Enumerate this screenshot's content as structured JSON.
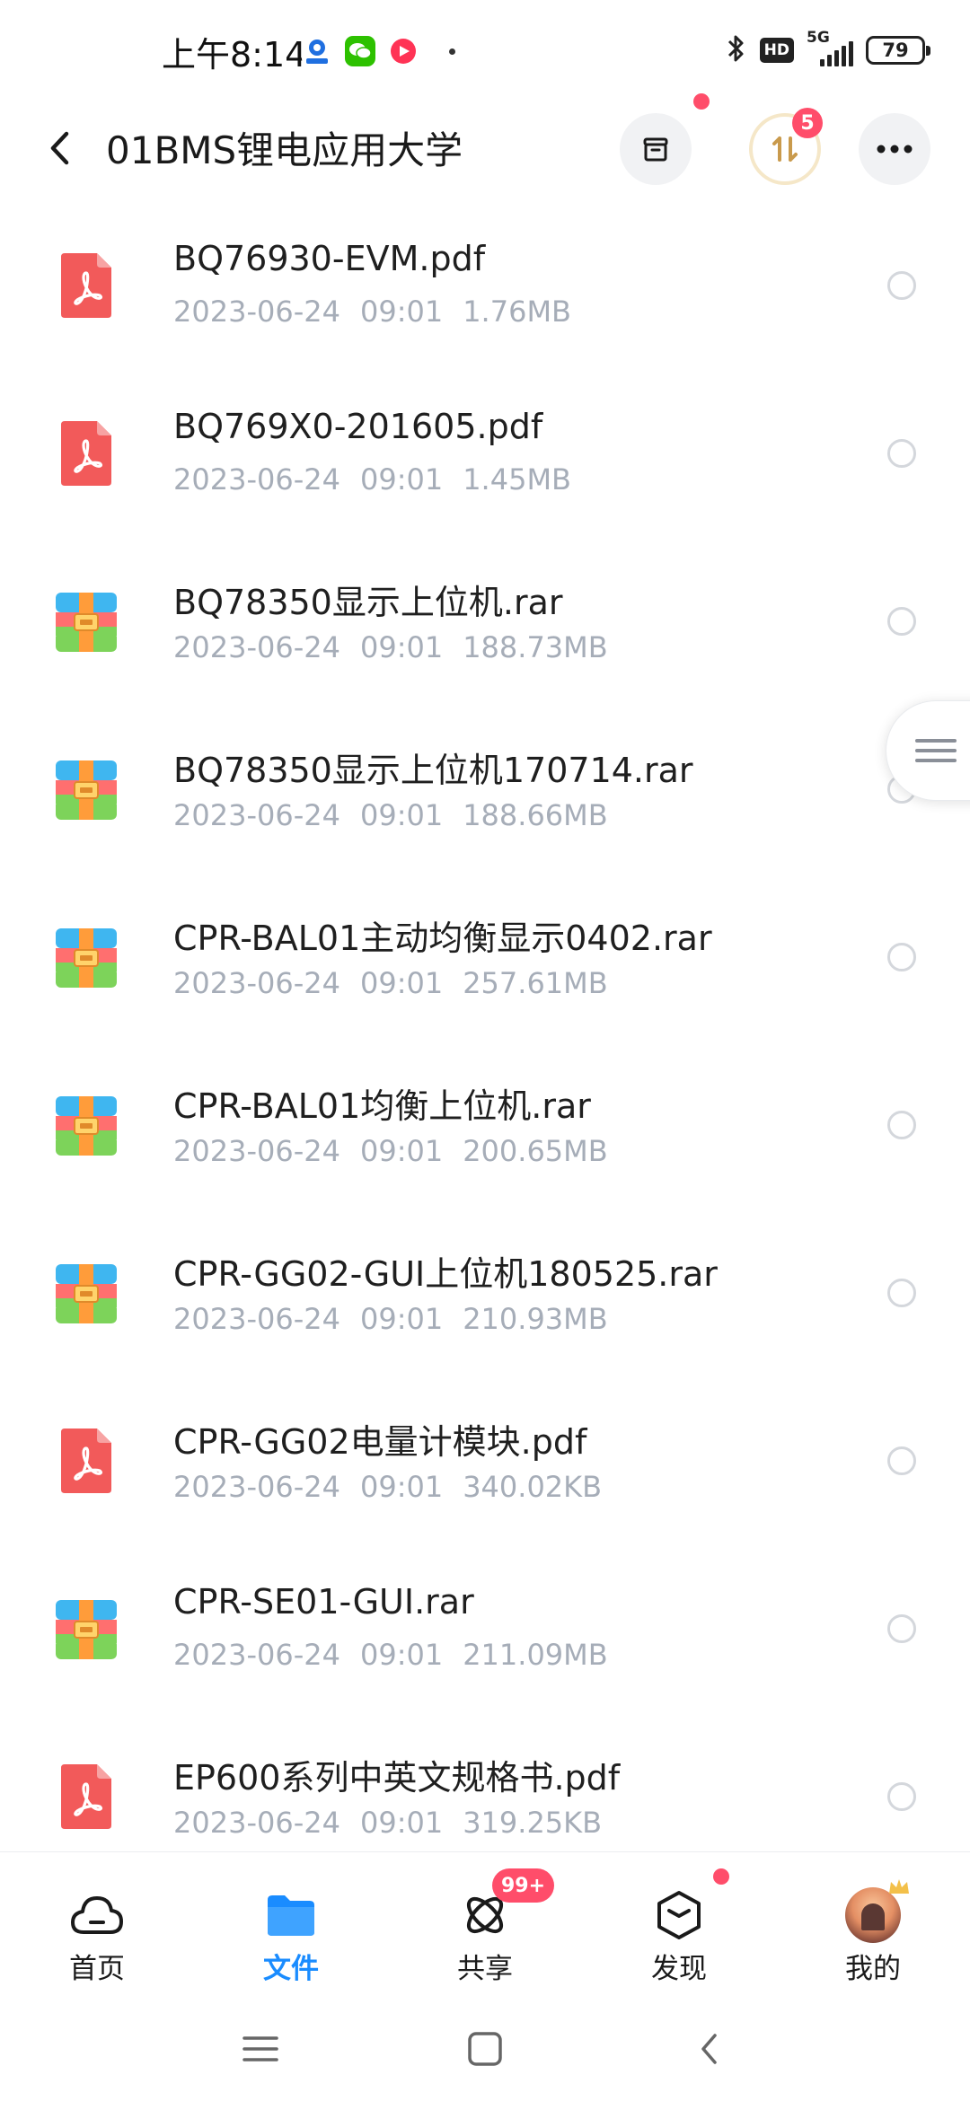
{
  "status_bar": {
    "time": "上午8:14",
    "network": "5G",
    "hd_label": "HD",
    "battery": "79"
  },
  "header": {
    "title": "01BMS锂电应用大学",
    "transfer_badge": "5"
  },
  "files": [
    {
      "name": "BQ76930-EVM.pdf",
      "date": "2023-06-24",
      "time": "09:01",
      "size": "1.76MB",
      "type": "pdf"
    },
    {
      "name": "BQ769X0-201605.pdf",
      "date": "2023-06-24",
      "time": "09:01",
      "size": "1.45MB",
      "type": "pdf"
    },
    {
      "name": "BQ78350显示上位机.rar",
      "date": "2023-06-24",
      "time": "09:01",
      "size": "188.73MB",
      "type": "rar"
    },
    {
      "name": "BQ78350显示上位机170714.rar",
      "date": "2023-06-24",
      "time": "09:01",
      "size": "188.66MB",
      "type": "rar"
    },
    {
      "name": "CPR-BAL01主动均衡显示0402.rar",
      "date": "2023-06-24",
      "time": "09:01",
      "size": "257.61MB",
      "type": "rar"
    },
    {
      "name": "CPR-BAL01均衡上位机.rar",
      "date": "2023-06-24",
      "time": "09:01",
      "size": "200.65MB",
      "type": "rar"
    },
    {
      "name": "CPR-GG02-GUI上位机180525.rar",
      "date": "2023-06-24",
      "time": "09:01",
      "size": "210.93MB",
      "type": "rar"
    },
    {
      "name": "CPR-GG02电量计模块.pdf",
      "date": "2023-06-24",
      "time": "09:01",
      "size": "340.02KB",
      "type": "pdf"
    },
    {
      "name": "CPR-SE01-GUI.rar",
      "date": "2023-06-24",
      "time": "09:01",
      "size": "211.09MB",
      "type": "rar"
    },
    {
      "name": "EP600系列中英文规格书.pdf",
      "date": "2023-06-24",
      "time": "09:01",
      "size": "319.25KB",
      "type": "pdf"
    }
  ],
  "bottom_nav": [
    {
      "label": "首页",
      "icon": "cloud-home-icon",
      "active": false
    },
    {
      "label": "文件",
      "icon": "folder-icon",
      "active": true
    },
    {
      "label": "共享",
      "icon": "share-atom-icon",
      "active": false,
      "badge": "99+"
    },
    {
      "label": "发现",
      "icon": "discover-cube-icon",
      "active": false
    },
    {
      "label": "我的",
      "icon": "avatar",
      "active": false
    }
  ],
  "colors": {
    "accent": "#1a8cff",
    "badge_red": "#ff4d6a",
    "pdf_red": "#f25a5a",
    "meta_gray": "#a6adb8"
  }
}
